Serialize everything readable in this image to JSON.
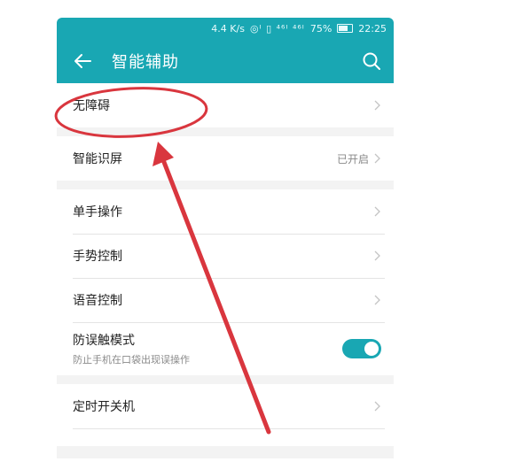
{
  "status_bar": {
    "speed": "4.4 K/s",
    "signal": "◎ᴵ ▯ ⁴⁶ᴵ ⁴⁶ᴵ",
    "battery": "75%",
    "time": "22:25"
  },
  "app_bar": {
    "title": "智能辅助"
  },
  "items": [
    {
      "label": "无障碍"
    },
    {
      "label": "智能识屏",
      "value": "已开启"
    },
    {
      "label": "单手操作"
    },
    {
      "label": "手势控制"
    },
    {
      "label": "语音控制"
    },
    {
      "label": "防误触模式",
      "subtitle": "防止手机在口袋出现误操作"
    },
    {
      "label": "定时开关机"
    }
  ],
  "colors": {
    "accent": "#19a7b3",
    "annotation": "#d9363e"
  }
}
